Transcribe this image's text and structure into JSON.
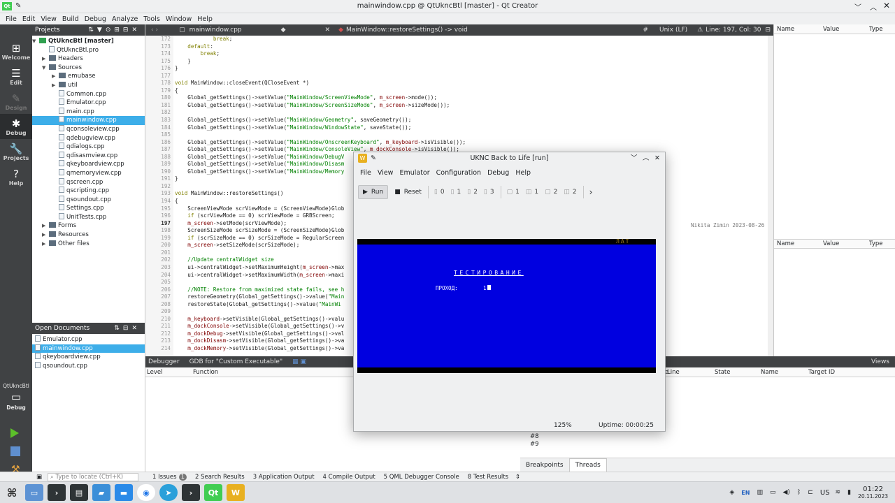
{
  "window": {
    "title": "mainwindow.cpp @ QtUkncBtl [master] - Qt Creator"
  },
  "menu": [
    "File",
    "Edit",
    "View",
    "Build",
    "Debug",
    "Analyze",
    "Tools",
    "Window",
    "Help"
  ],
  "modes": [
    {
      "label": "Welcome",
      "icon": "⊞"
    },
    {
      "label": "Edit",
      "icon": "☰"
    },
    {
      "label": "Design",
      "icon": "✎"
    },
    {
      "label": "Debug",
      "icon": "✱"
    },
    {
      "label": "Projects",
      "icon": "🔧"
    },
    {
      "label": "Help",
      "icon": "?"
    }
  ],
  "kit": {
    "name": "QtUkncBtl",
    "mode": "Debug"
  },
  "projects": {
    "header": "Projects",
    "root": "QtUkncBtl [master]",
    "pro": "QtUkncBtl.pro",
    "headers": "Headers",
    "sources": "Sources",
    "src_items": [
      "emubase",
      "util",
      "Common.cpp",
      "Emulator.cpp",
      "main.cpp",
      "mainwindow.cpp",
      "qconsoleview.cpp",
      "qdebugview.cpp",
      "qdialogs.cpp",
      "qdisasmview.cpp",
      "qkeyboardview.cpp",
      "qmemoryview.cpp",
      "qscreen.cpp",
      "qscripting.cpp",
      "qsoundout.cpp",
      "Settings.cpp",
      "UnitTests.cpp"
    ],
    "forms": "Forms",
    "resources": "Resources",
    "other": "Other files"
  },
  "opendocs": {
    "header": "Open Documents",
    "items": [
      "Emulator.cpp",
      "mainwindow.cpp",
      "qkeyboardview.cpp",
      "qsoundout.cpp"
    ]
  },
  "editor": {
    "file": "mainwindow.cpp",
    "symbol": "MainWindow::restoreSettings() -> void",
    "hash": "#",
    "eol": "Unix (LF)",
    "pos": "Line: 197, Col: 30",
    "blame": "Nikita Zimin 2023-08-26",
    "lines": [
      "172",
      "173",
      "174",
      "175",
      "176",
      "177",
      "178",
      "179",
      "180",
      "181",
      "182",
      "183",
      "184",
      "185",
      "186",
      "187",
      "188",
      "189",
      "190",
      "191",
      "192",
      "193",
      "194",
      "195",
      "196",
      "197",
      "198",
      "199",
      "200",
      "201",
      "202",
      "203",
      "204",
      "205",
      "206",
      "207",
      "208",
      "209",
      "210",
      "211",
      "212",
      "213",
      "214"
    ],
    "code": [
      "            break;",
      "    default:",
      "        break;",
      "    }",
      "}",
      "",
      "void MainWindow::closeEvent(QCloseEvent *)",
      "{",
      "    Global_getSettings()->setValue(\"MainWindow/ScreenViewMode\", m_screen->mode());",
      "    Global_getSettings()->setValue(\"MainWindow/ScreenSizeMode\", m_screen->sizeMode());",
      "",
      "    Global_getSettings()->setValue(\"MainWindow/Geometry\", saveGeometry());",
      "    Global_getSettings()->setValue(\"MainWindow/WindowState\", saveState());",
      "",
      "    Global_getSettings()->setValue(\"MainWindow/OnscreenKeyboard\", m_keyboard->isVisible());",
      "    Global_getSettings()->setValue(\"MainWindow/ConsoleView\", m_dockConsole->isVisible());",
      "    Global_getSettings()->setValue(\"MainWindow/DebugV",
      "    Global_getSettings()->setValue(\"MainWindow/Disasm",
      "    Global_getSettings()->setValue(\"MainWindow/Memory",
      "}",
      "",
      "void MainWindow::restoreSettings()",
      "{",
      "    ScreenViewMode scrViewMode = (ScreenViewMode)Glob",
      "    if (scrViewMode == 0) scrViewMode = GRBScreen;",
      "    m_screen->setMode(scrViewMode);",
      "    ScreenSizeMode scrSizeMode = (ScreenSizeMode)Glob",
      "    if (scrSizeMode == 0) scrSizeMode = RegularScreen",
      "    m_screen->setSizeMode(scrSizeMode);",
      "",
      "    //Update centralWidget size",
      "    ui->centralWidget->setMaximumHeight(m_screen->max",
      "    ui->centralWidget->setMaximumWidth(m_screen->maxi",
      "",
      "    //NOTE: Restore from maximized state fails, see h",
      "    restoreGeometry(Global_getSettings()->value(\"Main",
      "    restoreState(Global_getSettings()->value(\"MainWi",
      "",
      "    m_keyboard->setVisible(Global_getSettings()->valu",
      "    m_dockConsole->setVisible(Global_getSettings()->v",
      "    m_dockDebug->setVisible(Global_getSettings()->val",
      "    m_dockDisasm->setVisible(Global_getSettings()->va",
      "    m_dockMemory->setVisible(Global_getSettings()->va"
    ]
  },
  "locals": {
    "cols": [
      "Name",
      "Value",
      "Type"
    ]
  },
  "debugger": {
    "tab": "Debugger",
    "engine": "GDB for \"Custom Executable\"",
    "cols_left": [
      "Level",
      "Function"
    ],
    "cols_right": [
      "le",
      "Line",
      "State",
      "Name",
      "Target ID"
    ],
    "views": "Views",
    "frames": [
      "#8",
      "#9"
    ],
    "tabs": [
      "Breakpoints",
      "Threads"
    ]
  },
  "statusbar": {
    "locate": "Type to locate (Ctrl+K)",
    "tabs": [
      "1  Issues",
      "2  Search Results",
      "3  Application Output",
      "4  Compile Output",
      "5  QML Debugger Console",
      "8  Test Results"
    ],
    "issues_count": "1"
  },
  "uknc": {
    "title": "UKNC Back to Life [run]",
    "menu": [
      "File",
      "View",
      "Emulator",
      "Configuration",
      "Debug",
      "Help"
    ],
    "run": "Run",
    "reset": "Reset",
    "drives": [
      "0",
      "1",
      "2",
      "3"
    ],
    "hds": [
      "1",
      "1",
      "2",
      "2"
    ],
    "screen_lat": "ЛАТ",
    "screen_heading": "ТЕСТИРОВАНИЕ",
    "screen_label": "ПРОХОД:",
    "screen_value": "1",
    "zoom": "125%",
    "uptime": "Uptime: 00:00:25"
  },
  "tray": {
    "lang": "EN",
    "kbd": "US",
    "time": "01:22",
    "date": "20.11.2023"
  }
}
